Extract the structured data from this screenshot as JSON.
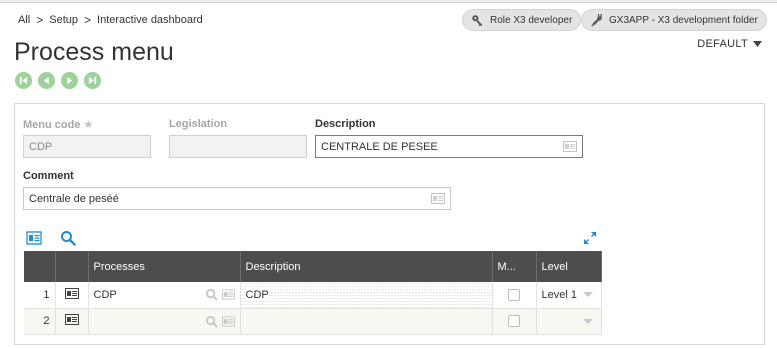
{
  "breadcrumb": [
    {
      "label": "All"
    },
    {
      "label": "Setup"
    },
    {
      "label": "Interactive dashboard"
    }
  ],
  "header": {
    "role_label": "Role X3 developer",
    "folder_label": "GX3APP - X3 development folder",
    "title": "Process menu",
    "view_selector": "DEFAULT"
  },
  "form": {
    "menu_code": {
      "label": "Menu code",
      "value": "CDP"
    },
    "legislation": {
      "label": "Legislation",
      "value": ""
    },
    "description": {
      "label": "Description",
      "value": "CENTRALE DE PESEE"
    },
    "comment": {
      "label": "Comment",
      "value": "Centrale de peséé"
    }
  },
  "grid": {
    "columns": [
      "Processes",
      "Description",
      "M...",
      "Level"
    ],
    "rows": [
      {
        "num": "1",
        "process": "CDP",
        "description": "CDP",
        "level": "Level 1"
      },
      {
        "num": "2",
        "process": "",
        "description": "",
        "level": ""
      }
    ]
  },
  "colors": {
    "accent_green": "#9bd39b",
    "grid_header": "#4d4d4d",
    "link_blue": "#1f8dd6"
  }
}
